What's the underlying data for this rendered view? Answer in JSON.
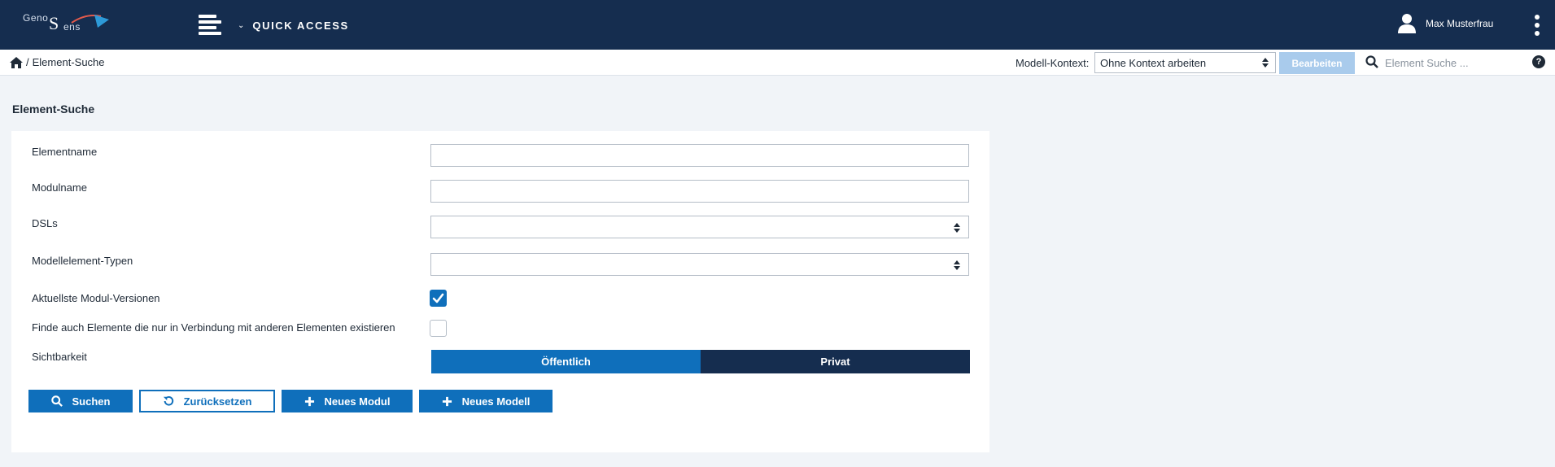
{
  "header": {
    "logo": {
      "part1": "Geno",
      "part2": "S",
      "part3": "ens"
    },
    "quick_access": "QUICK ACCESS",
    "user_name": "Max Musterfrau"
  },
  "subbar": {
    "breadcrumb_current": "Element-Suche",
    "breadcrumb_sep": "/",
    "context_label": "Modell-Kontext:",
    "context_value": "Ohne Kontext arbeiten",
    "edit_label": "Bearbeiten",
    "search_placeholder": "Element Suche ...",
    "help": "?"
  },
  "page": {
    "title": "Element-Suche"
  },
  "form": {
    "element_name_label": "Elementname",
    "element_name_value": "",
    "module_name_label": "Modulname",
    "module_name_value": "",
    "dsls_label": "DSLs",
    "dsls_value": "",
    "types_label": "Modellelement-Typen",
    "types_value": "",
    "latest_versions_label": "Aktuellste Modul-Versionen",
    "latest_versions_checked": true,
    "also_connected_label": "Finde auch Elemente die nur in Verbindung mit anderen Elementen existieren",
    "also_connected_checked": false,
    "visibility_label": "Sichtbarkeit",
    "visibility_options": [
      "Öffentlich",
      "Privat"
    ],
    "visibility_selected": "Öffentlich"
  },
  "buttons": {
    "search": "Suchen",
    "reset": "Zurücksetzen",
    "new_module": "Neues Modul",
    "new_model": "Neues Modell"
  },
  "colors": {
    "header_bg": "#152d4f",
    "primary": "#0f6fbb",
    "disabled_primary": "#a9cbec",
    "page_bg": "#f1f4f8"
  }
}
